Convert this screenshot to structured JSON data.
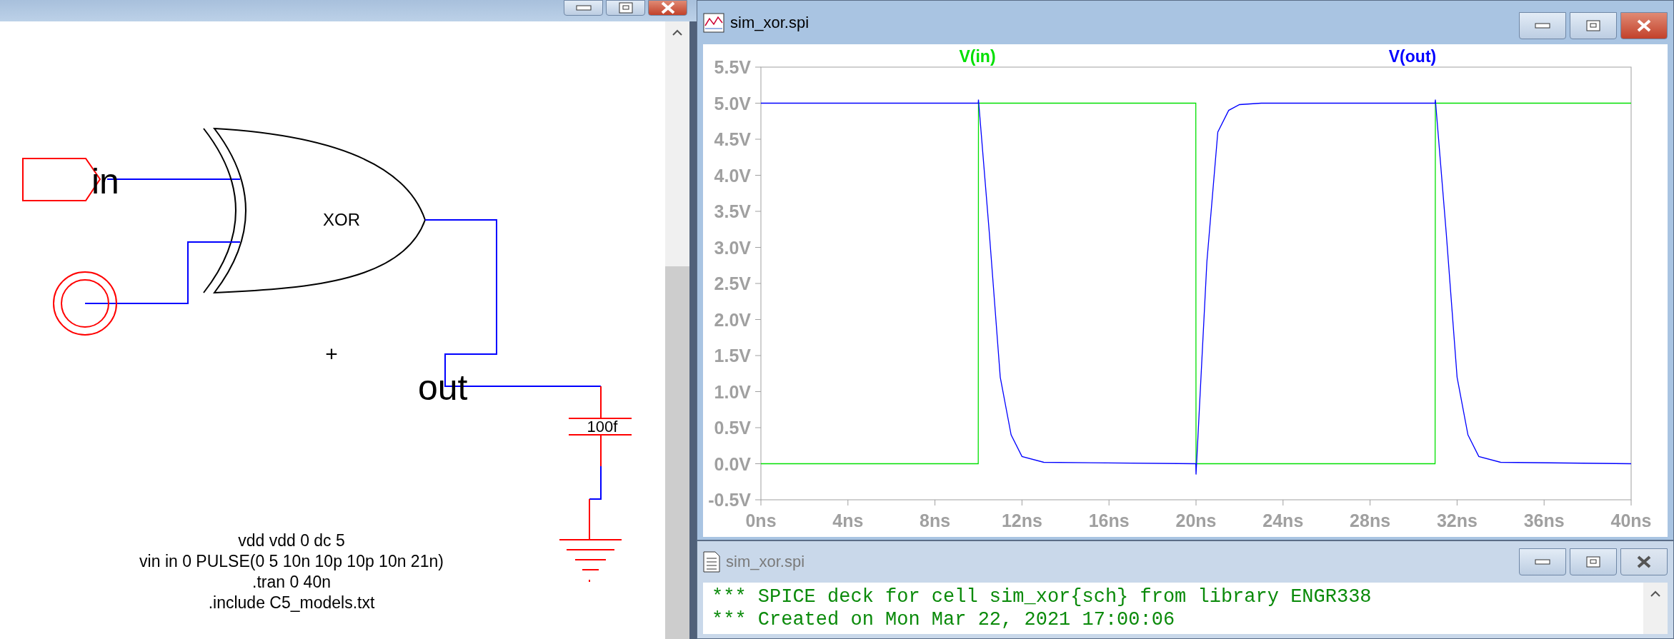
{
  "schematic": {
    "input_port": "in",
    "gate": "XOR",
    "output_label": "out",
    "capacitor": "100f",
    "cursor": "+",
    "directives": [
      "vdd vdd 0 dc 5",
      "vin in 0 PULSE(0 5 10n 10p 10p 10n 21n)",
      ".tran 0 40n",
      ".include C5_models.txt"
    ]
  },
  "plot_window": {
    "title": "sim_xor.spi",
    "active": true,
    "chart_data": {
      "type": "line",
      "xlim": [
        0,
        40
      ],
      "ylim": [
        -0.5,
        5.5
      ],
      "x": [
        0,
        9.99,
        10,
        10.5,
        11,
        11.5,
        12,
        13,
        19.99,
        20,
        20.5,
        21,
        21.5,
        22,
        23,
        30.99,
        31,
        31.5,
        32,
        32.5,
        33,
        34,
        40
      ],
      "series": [
        {
          "name": "V(in)",
          "color": "#00e000",
          "values": [
            0,
            0,
            5,
            5,
            5,
            5,
            5,
            5,
            5,
            0,
            0,
            0,
            0,
            0,
            0,
            0,
            5,
            5,
            5,
            5,
            5,
            5,
            5
          ]
        },
        {
          "name": "V(out)",
          "color": "#0000ff",
          "values": [
            5,
            5,
            5.05,
            3.2,
            1.2,
            0.4,
            0.1,
            0.02,
            0,
            -0.15,
            2.8,
            4.6,
            4.9,
            4.98,
            5,
            5,
            5.05,
            3.2,
            1.2,
            0.4,
            0.1,
            0.02,
            0
          ]
        }
      ],
      "xticks": [
        {
          "value": 0,
          "label": "0ns"
        },
        {
          "value": 4,
          "label": "4ns"
        },
        {
          "value": 8,
          "label": "8ns"
        },
        {
          "value": 12,
          "label": "12ns"
        },
        {
          "value": 16,
          "label": "16ns"
        },
        {
          "value": 20,
          "label": "20ns"
        },
        {
          "value": 24,
          "label": "24ns"
        },
        {
          "value": 28,
          "label": "28ns"
        },
        {
          "value": 32,
          "label": "32ns"
        },
        {
          "value": 36,
          "label": "36ns"
        },
        {
          "value": 40,
          "label": "40ns"
        }
      ],
      "yticks": [
        {
          "value": -0.5,
          "label": "-0.5V"
        },
        {
          "value": 0,
          "label": "0.0V"
        },
        {
          "value": 0.5,
          "label": "0.5V"
        },
        {
          "value": 1,
          "label": "1.0V"
        },
        {
          "value": 1.5,
          "label": "1.5V"
        },
        {
          "value": 2,
          "label": "2.0V"
        },
        {
          "value": 2.5,
          "label": "2.5V"
        },
        {
          "value": 3,
          "label": "3.0V"
        },
        {
          "value": 3.5,
          "label": "3.5V"
        },
        {
          "value": 4,
          "label": "4.0V"
        },
        {
          "value": 4.5,
          "label": "4.5V"
        },
        {
          "value": 5,
          "label": "5.0V"
        },
        {
          "value": 5.5,
          "label": "5.5V"
        }
      ]
    }
  },
  "deck_window": {
    "title": "sim_xor.spi",
    "active": false,
    "lines": [
      "*** SPICE deck for cell sim_xor{sch} from library ENGR338",
      "*** Created on Mon Mar 22, 2021 17:00:06"
    ]
  }
}
